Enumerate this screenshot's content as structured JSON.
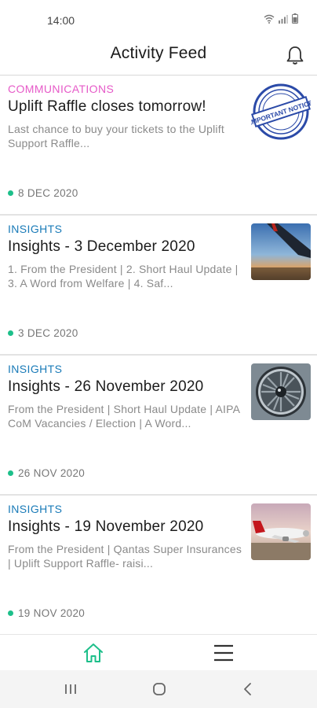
{
  "status_bar": {
    "time": "14:00"
  },
  "header": {
    "title": "Activity Feed"
  },
  "feed": [
    {
      "category": "COMMUNICATIONS",
      "category_color": "#e65ac8",
      "title": "Uplift Raffle closes tomorrow!",
      "excerpt": "Last chance to buy your tickets to the Uplift Support Raffle...",
      "date": "8 DEC 2020",
      "thumb": "important-notice-stamp",
      "thumb_stamp_text": "IMPORTANT NOTICE"
    },
    {
      "category": "INSIGHTS",
      "category_color": "#1a7bb8",
      "title": "Insights - 3 December 2020",
      "excerpt": "1. From the President | 2. Short Haul Update | 3. A Word from Welfare | 4. Saf...",
      "date": "3 DEC 2020",
      "thumb": "airplane-wing-photo"
    },
    {
      "category": "INSIGHTS",
      "category_color": "#1a7bb8",
      "title": "Insights - 26 November 2020",
      "excerpt": "From the President | Short Haul Update | AIPA CoM Vacancies / Election | A Word...",
      "date": "26 NOV 2020",
      "thumb": "jet-engine-photo"
    },
    {
      "category": "INSIGHTS",
      "category_color": "#1a7bb8",
      "title": "Insights - 19 November 2020",
      "excerpt": "From the President | Qantas Super Insurances | Uplift Support Raffle- raisi...",
      "date": "19 NOV 2020",
      "thumb": "parked-aircraft-photo"
    }
  ],
  "accent_color": "#1dbf8a"
}
